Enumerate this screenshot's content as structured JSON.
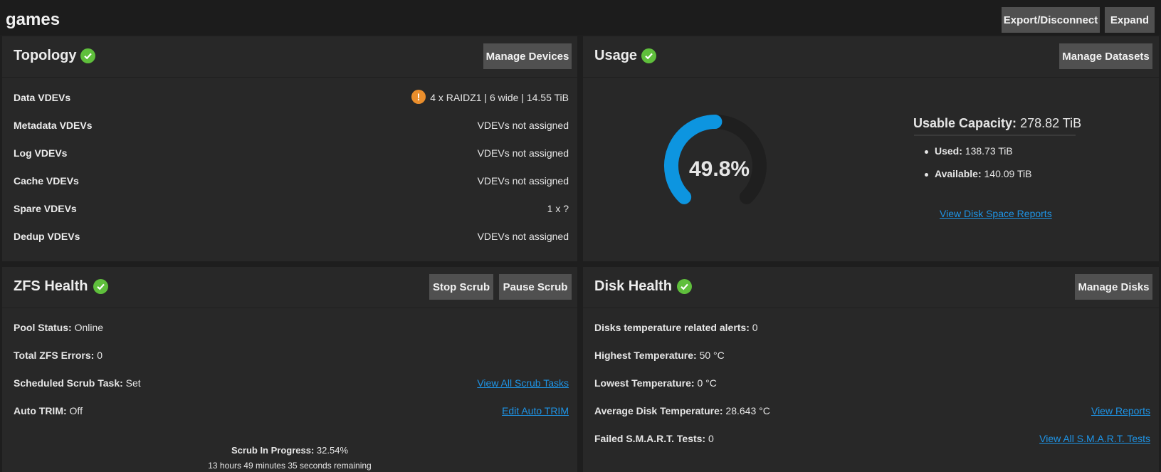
{
  "header": {
    "pool_name": "games",
    "export_label": "Export/Disconnect",
    "expand_label": "Expand"
  },
  "topology": {
    "title": "Topology",
    "manage_label": "Manage Devices",
    "rows": [
      {
        "label": "Data VDEVs",
        "value": "4 x RAIDZ1 | 6 wide | 14.55 TiB"
      },
      {
        "label": "Metadata VDEVs",
        "value": "VDEVs not assigned"
      },
      {
        "label": "Log VDEVs",
        "value": "VDEVs not assigned"
      },
      {
        "label": "Cache VDEVs",
        "value": "VDEVs not assigned"
      },
      {
        "label": "Spare VDEVs",
        "value": "1 x ?"
      },
      {
        "label": "Dedup VDEVs",
        "value": "VDEVs not assigned"
      }
    ],
    "warn_glyph": "!"
  },
  "usage": {
    "title": "Usage",
    "manage_label": "Manage Datasets",
    "percent_text": "49.8%",
    "percent_value": 49.8,
    "capacity_label": "Usable Capacity:",
    "capacity_value": "278.82 TiB",
    "used_label": "Used:",
    "used_value": "138.73 TiB",
    "available_label": "Available:",
    "available_value": "140.09 TiB",
    "reports_link": "View Disk Space Reports"
  },
  "zfs": {
    "title": "ZFS Health",
    "stop_label": "Stop Scrub",
    "pause_label": "Pause Scrub",
    "status_label": "Pool Status:",
    "status_value": "Online",
    "errors_label": "Total ZFS Errors:",
    "errors_value": "0",
    "scrub_label": "Scheduled Scrub Task:",
    "scrub_value": "Set",
    "scrub_link": "View All Scrub Tasks",
    "trim_label": "Auto TRIM:",
    "trim_value": "Off",
    "trim_link": "Edit Auto TRIM",
    "progress_label": "Scrub In Progress:",
    "progress_value": "32.54%",
    "remaining": "13 hours 49 minutes 35 seconds remaining"
  },
  "disk": {
    "title": "Disk Health",
    "manage_label": "Manage Disks",
    "alerts_label": "Disks temperature related alerts:",
    "alerts_value": "0",
    "highest_label": "Highest Temperature:",
    "highest_value": "50 °C",
    "lowest_label": "Lowest Temperature:",
    "lowest_value": "0 °C",
    "avg_label": "Average Disk Temperature:",
    "avg_value": "28.643 °C",
    "reports_link": "View Reports",
    "smart_label": "Failed S.M.A.R.T. Tests:",
    "smart_value": "0",
    "smart_link": "View All S.M.A.R.T. Tests"
  },
  "colors": {
    "ok": "#5fbf3c",
    "warn": "#ea8e2c",
    "gauge_fill": "#0d95e0",
    "gauge_track": "#1f1f1f",
    "link": "#1e94e6"
  }
}
